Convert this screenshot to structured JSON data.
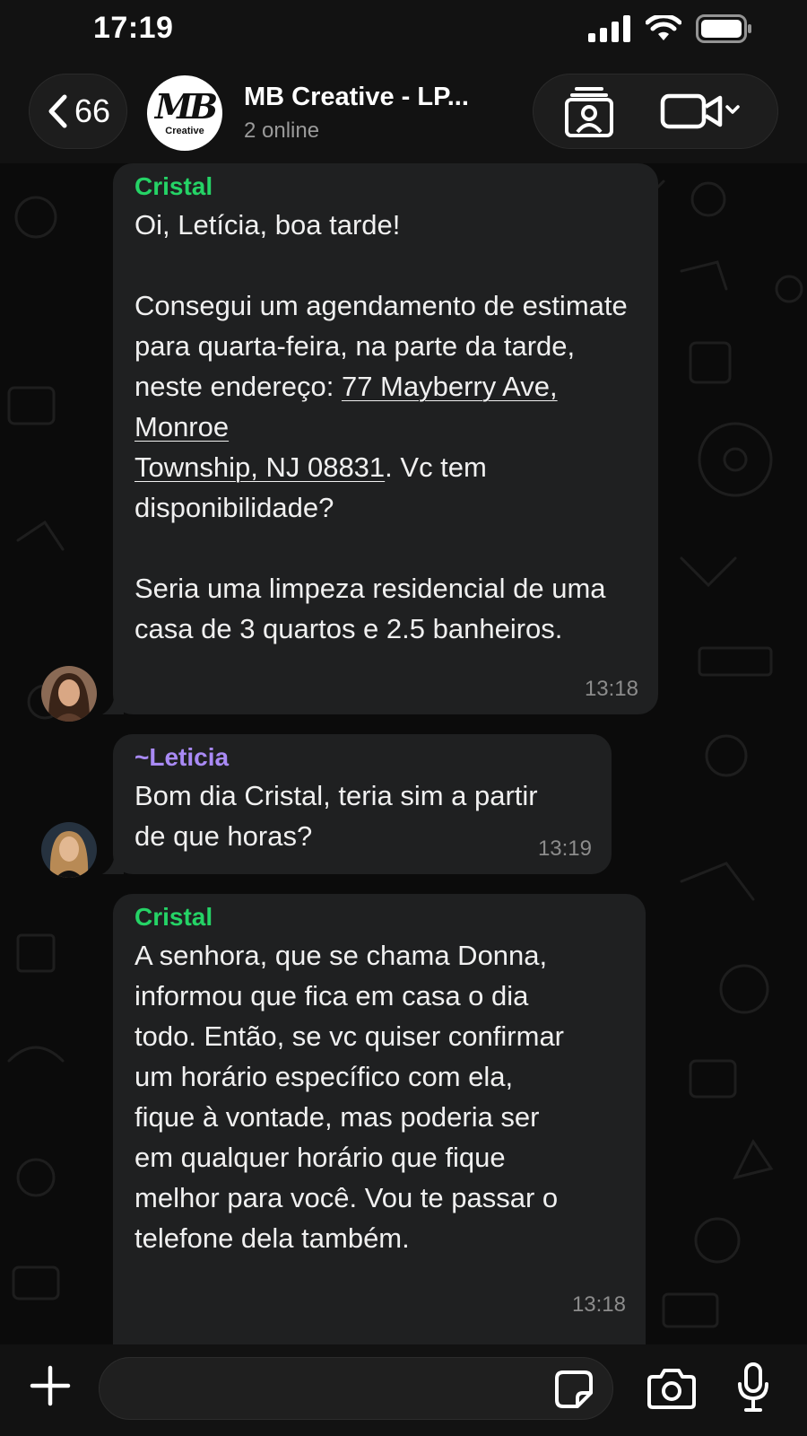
{
  "status_bar": {
    "time": "17:19"
  },
  "header": {
    "back_count": "66",
    "group_logo_mark": "MB",
    "group_logo_text": "Creative",
    "title": "MB Creative - LP...",
    "subtitle": "2 online"
  },
  "messages": [
    {
      "sender": "Cristal",
      "sender_color": "#25d366",
      "text_before": "Oi, Letícia, boa tarde!\n\nConsegui um agendamento de estimate para quarta-feira, na parte da tarde, neste endereço: ",
      "address_line1": "77 Mayberry Ave, Monroe",
      "address_line2": "Township, NJ 08831",
      "text_after": ". Vc tem disponibilidade?\n\nSeria uma limpeza residencial de uma casa de 3 quartos e 2.5 banheiros.",
      "time": "13:18"
    },
    {
      "sender": "~Leticia",
      "sender_color": "#a98af5",
      "text": "Bom dia Cristal, teria sim a partir de que horas?",
      "time": "13:19"
    },
    {
      "sender": "Cristal",
      "sender_color": "#25d366",
      "text": "A senhora, que se chama Donna, informou que fica em casa o dia todo. Então, se vc quiser confirmar um horário específico com ela, fique à vontade, mas poderia ser em qualquer horário que fique melhor para você. Vou te passar o telefone dela também.",
      "time": "13:18"
    }
  ],
  "composer": {
    "value": "",
    "placeholder": ""
  },
  "icons": {
    "back": "chevron-left-icon",
    "contact": "contact-card-icon",
    "video": "video-camera-icon",
    "plus": "plus-icon",
    "sticker": "sticker-icon",
    "camera": "camera-icon",
    "mic": "microphone-icon"
  },
  "colors": {
    "background": "#0a0a0a",
    "bubble": "#1f2021",
    "cristal_name": "#25d366",
    "leticia_name": "#a98af5",
    "timestamp": "#8c8c8c"
  }
}
